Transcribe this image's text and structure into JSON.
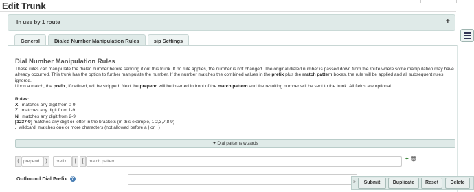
{
  "page": {
    "title": "Edit Trunk"
  },
  "route_panel": {
    "text": "In use by 1 route",
    "toggle": "+"
  },
  "tabs": [
    {
      "label": "General",
      "active": false
    },
    {
      "label": "Dialed Number Manipulation Rules",
      "active": true
    },
    {
      "label": "sip Settings",
      "active": false
    }
  ],
  "section": {
    "title": "Dial Number Manipulation Rules",
    "p1_a": "These rules can manipulate the dialed number before sending it out this trunk. If no rule applies, the number is not changed. The original dialed number is passed down from the route where some manipulation may have already occurred. This trunk has the option to further manipulate the number. If the number matches the combined values in the ",
    "p1_prefix": "prefix",
    "p1_b": " plus the ",
    "p1_match": "match pattern",
    "p1_c": " boxes, the rule will be applied and all subsequent rules ignored.",
    "p2_a": "Upon a match, the ",
    "p2_prefix": "prefix",
    "p2_b": ", if defined, will be stripped. Next the ",
    "p2_prepend": "prepend",
    "p2_c": " will be inserted in front of the ",
    "p2_match": "match pattern",
    "p2_d": " and the resulting number will be sent to the trunk. All fields are optional."
  },
  "rules": {
    "title": "Rules:",
    "items": [
      {
        "key": "X",
        "text": "   matches any digit from 0-9"
      },
      {
        "key": "Z",
        "text": "   matches any digit from 1-9"
      },
      {
        "key": "N",
        "text": "   matches any digit from 2-9"
      },
      {
        "key": "[1237-9]",
        "text": " matches any digit or letter in the brackets (in this example, 1,2,3,7,8,9)"
      },
      {
        "key": ".",
        "text": "  wildcard, matches one or more characters (not allowed before a | or +)"
      }
    ]
  },
  "wizard": {
    "icon": "magic-wand-icon",
    "label": "Dial patterns wizards"
  },
  "pattern_row": {
    "open_paren": "(",
    "close_paren": ")",
    "pipe": "|",
    "bracket": "[",
    "prepend_placeholder": "prepend",
    "prefix_placeholder": "prefix",
    "match_placeholder": "match pattern",
    "add_icon": "+",
    "delete_icon": "trash-icon"
  },
  "outbound": {
    "label": "Outbound Dial Prefix",
    "help": "?",
    "value": ""
  },
  "actions": {
    "collapse": "»",
    "submit": "Submit",
    "duplicate": "Duplicate",
    "reset": "Reset",
    "delete": "Delete"
  },
  "colors": {
    "panel": "#dfeae8",
    "accent": "#4a7fb5"
  }
}
